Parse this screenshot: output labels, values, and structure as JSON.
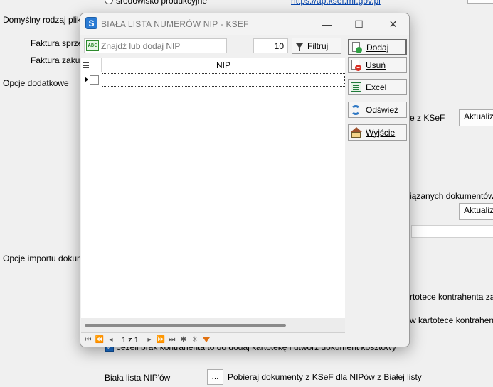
{
  "background": {
    "radio_label": "środowisko produkcyjne",
    "link": "https://ap.ksef.mf.gov.pl",
    "default_file_type_label": "Domyślny rodzaj pliku F",
    "sales_invoice_label": "Faktura sprzed",
    "purchase_invoice_label": "Faktura zakup",
    "additional_options_label": "Opcje dodatkowe",
    "ksef_text": "e z KSeF",
    "update_button_1": "Aktualizu",
    "linked_docs_text": "iązanych dokumentów dl",
    "update_button_2": "Aktualizu",
    "import_options_label": "Opcje importu dokumen",
    "contractor_card_text_1": "rtotece kontrahenta zazn",
    "contractor_card_text_2": "w kartotece kontrahenta",
    "checkbox_text": "Jeżeli brak kontrahenta to do dodaj kartotekę i utwórz dokument kosztowy",
    "whitelist_label": "Biała lista NIP'ów",
    "ellipsis_button": "...",
    "fetch_text": "Pobieraj dokumenty z KSeF dla NIPów z Białej listy"
  },
  "dialog": {
    "title": "BIAŁA LISTA NUMERÓW NIP - KSEF",
    "app_icon": "S",
    "controls": {
      "minimize": "—",
      "maximize": "☐",
      "close": "✕"
    },
    "search": {
      "icon_text": "ABC",
      "placeholder": "Znajdź lub dodaj NIP",
      "value": ""
    },
    "count": "10",
    "filter_button": "Filtruj",
    "grid": {
      "columns": [
        "NIP"
      ],
      "rows": [
        {
          "nip": "",
          "checked": false
        }
      ]
    },
    "navigator": {
      "page_text": "1 z 1"
    },
    "buttons": {
      "add": "Dodaj",
      "delete": "Usuń",
      "excel": "Excel",
      "refresh": "Odśwież",
      "exit": "Wyjście"
    }
  },
  "colors": {
    "accent": "#2a7bd4",
    "add_badge": "#2ea043",
    "delete_badge": "#d93025",
    "filter_orange": "#e07010"
  }
}
